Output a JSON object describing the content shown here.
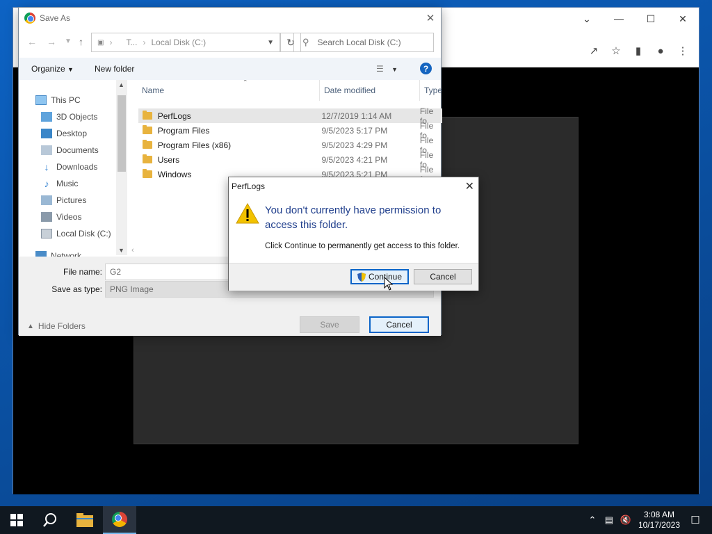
{
  "save_dialog": {
    "title": "Save As",
    "address_segments": [
      "T...",
      "Local Disk (C:)"
    ],
    "search_placeholder": "Search Local Disk (C:)",
    "organize_label": "Organize",
    "new_folder_label": "New folder",
    "nav_items": [
      {
        "label": "This PC",
        "icon": "pc-icon"
      },
      {
        "label": "3D Objects",
        "icon": "cube-icon"
      },
      {
        "label": "Desktop",
        "icon": "desktop-icon"
      },
      {
        "label": "Documents",
        "icon": "documents-icon"
      },
      {
        "label": "Downloads",
        "icon": "download-icon"
      },
      {
        "label": "Music",
        "icon": "music-icon"
      },
      {
        "label": "Pictures",
        "icon": "pictures-icon"
      },
      {
        "label": "Videos",
        "icon": "videos-icon"
      },
      {
        "label": "Local Disk (C:)",
        "icon": "disk-icon"
      },
      {
        "label": "Network",
        "icon": "network-icon"
      }
    ],
    "columns": {
      "name": "Name",
      "date": "Date modified",
      "type": "Type"
    },
    "files": [
      {
        "name": "PerfLogs",
        "date": "12/7/2019 1:14 AM",
        "type": "File fo"
      },
      {
        "name": "Program Files",
        "date": "9/5/2023 5:17 PM",
        "type": "File fo"
      },
      {
        "name": "Program Files (x86)",
        "date": "9/5/2023 4:29 PM",
        "type": "File fo"
      },
      {
        "name": "Users",
        "date": "9/5/2023 4:21 PM",
        "type": "File fo"
      },
      {
        "name": "Windows",
        "date": "9/5/2023 5:21 PM",
        "type": "File fo"
      }
    ],
    "file_name_label": "File name:",
    "file_name_value": "G2",
    "save_type_label": "Save as type:",
    "save_type_value": "PNG Image",
    "save_button": "Save",
    "cancel_button": "Cancel",
    "hide_folders": "Hide Folders"
  },
  "permission_dialog": {
    "title": "PerfLogs",
    "message": "You don't currently have permission to access this folder.",
    "detail": "Click Continue to permanently get access to this folder.",
    "continue_button": "Continue",
    "cancel_button": "Cancel"
  },
  "taskbar": {
    "time": "3:08 AM",
    "date": "10/17/2023"
  },
  "colors": {
    "accent": "#0a64c8",
    "folder": "#e8b33e",
    "warning": "#f2c200"
  }
}
